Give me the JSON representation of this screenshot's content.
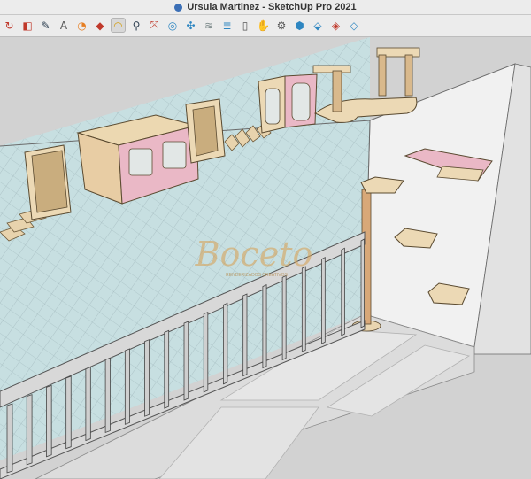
{
  "window": {
    "title": "Ursula Martinez - SketchUp Pro 2021"
  },
  "toolbar": {
    "tools": [
      {
        "icon": "undo-arc-icon",
        "glyph": "↻",
        "color": "#c0392b"
      },
      {
        "icon": "paint-bucket-icon",
        "glyph": "◧",
        "color": "#c0392b"
      },
      {
        "icon": "pencil-icon",
        "glyph": "✎",
        "color": "#2c3e50"
      },
      {
        "icon": "text-icon",
        "glyph": "A",
        "color": "#555"
      },
      {
        "icon": "pie-tool-icon",
        "glyph": "◔",
        "color": "#e67e22"
      },
      {
        "icon": "paint-icon",
        "glyph": "◆",
        "color": "#c0392b"
      },
      {
        "icon": "arc-tool-icon",
        "glyph": "◠",
        "color": "#d4a017",
        "active": true
      },
      {
        "icon": "magnify-icon",
        "glyph": "⚲",
        "color": "#2c3e50"
      },
      {
        "icon": "scale-icon",
        "glyph": "⤧",
        "color": "#c0392b"
      },
      {
        "icon": "orbit-icon",
        "glyph": "◎",
        "color": "#2e86c1"
      },
      {
        "icon": "intersect-icon",
        "glyph": "✣",
        "color": "#2e86c1"
      },
      {
        "icon": "sandbox-icon",
        "glyph": "≋",
        "color": "#7f8c8d"
      },
      {
        "icon": "layers-icon",
        "glyph": "≣",
        "color": "#2e86c1"
      },
      {
        "icon": "section-plane-icon",
        "glyph": "▯",
        "color": "#555"
      },
      {
        "icon": "pan-hand-icon",
        "glyph": "✋",
        "color": "#555"
      },
      {
        "icon": "settings-icon",
        "glyph": "⚙",
        "color": "#555"
      },
      {
        "icon": "materials-icon",
        "glyph": "⬢",
        "color": "#2e86c1"
      },
      {
        "icon": "components-icon",
        "glyph": "⬙",
        "color": "#2e86c1"
      },
      {
        "icon": "styles-icon",
        "glyph": "◈",
        "color": "#c0392b"
      },
      {
        "icon": "outliner-icon",
        "glyph": "◇",
        "color": "#2e86c1"
      }
    ]
  },
  "viewport": {
    "watermark": "Boceto",
    "watermark_sub": "RENDERIZADOS CREATIVOS"
  }
}
